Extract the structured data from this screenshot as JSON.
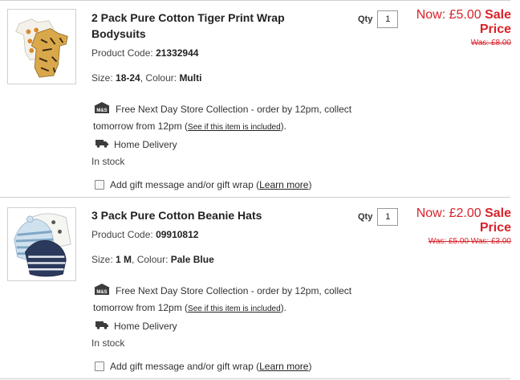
{
  "items": [
    {
      "title_line1": "2 Pack Pure Cotton Tiger Print Wrap",
      "title_line2": "Bodysuits",
      "code_label": "Product Code:",
      "code": "21332944",
      "size_label": "Size:",
      "size": "18-24",
      "colour_label": ", Colour:",
      "colour": "Multi",
      "store_text": "Free Next Day Store Collection - order by 12pm, collect",
      "store_text2": "tomorrow from 12pm (",
      "store_link": "See if this item is included",
      "store_end": ").",
      "delivery": "Home Delivery",
      "stock": "In stock",
      "gift_text": "Add gift message and/or gift wrap (",
      "gift_link": "Learn more",
      "gift_end": ")",
      "qty_label": "Qty",
      "qty": "1",
      "now_label": "Now: £5.00",
      "sale_label": "Sale",
      "sale_price": "Price",
      "was": "Was: £8.00"
    },
    {
      "title_line1": "3 Pack Pure Cotton Beanie Hats",
      "code_label": "Product Code:",
      "code": "09910812",
      "size_label": "Size:",
      "size": "1 M",
      "colour_label": ", Colour:",
      "colour": "Pale Blue",
      "store_text": "Free Next Day Store Collection - order by 12pm, collect",
      "store_text2": "tomorrow from 12pm (",
      "store_link": "See if this item is included",
      "store_end": ").",
      "delivery": "Home Delivery",
      "stock": "In stock",
      "gift_text": "Add gift message and/or gift wrap (",
      "gift_link": "Learn more",
      "gift_end": ")",
      "qty_label": "Qty",
      "qty": "1",
      "now_label": "Now: £2.00",
      "sale_label": "Sale",
      "sale_price": "Price",
      "was": "Was: £5.00 Was: £3.00"
    }
  ],
  "store_badge": "M&S",
  "colors": {
    "sale_red": "#d8222a",
    "divider": "#cfcfcf"
  }
}
